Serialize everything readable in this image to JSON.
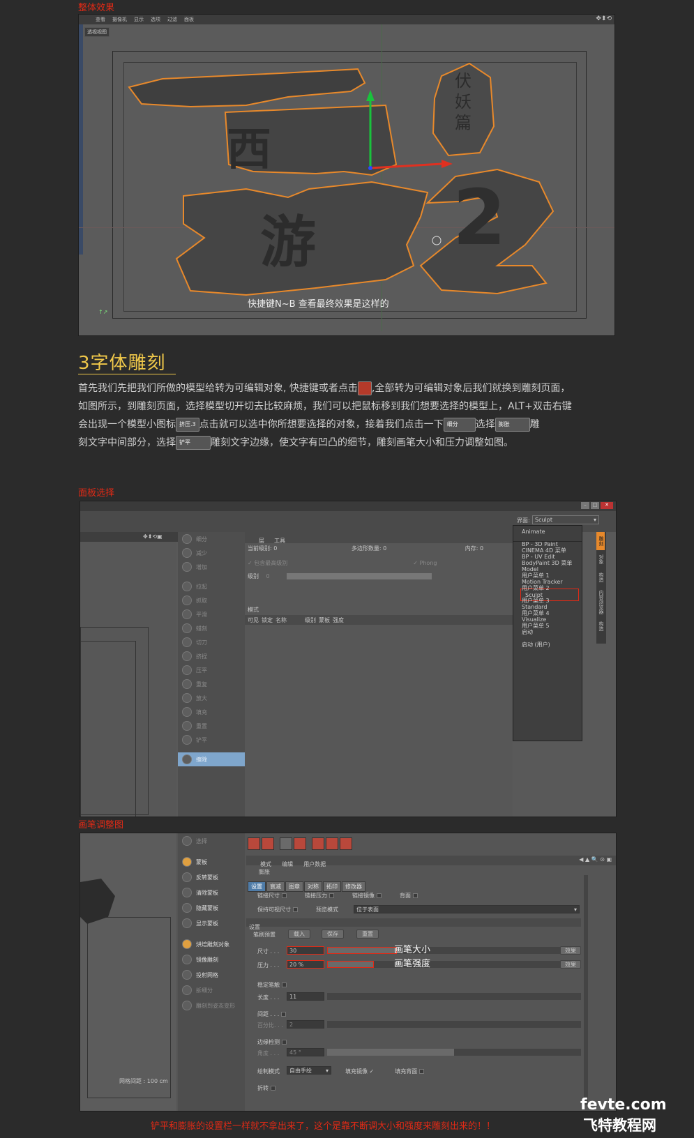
{
  "sections": {
    "overall_title": "整体效果",
    "panel_select_title": "面板选择",
    "brush_adjust_title": "画笔调整图"
  },
  "viewport1": {
    "menu": [
      "查看",
      "摄像机",
      "显示",
      "选项",
      "过滤",
      "面板"
    ],
    "view_tag": "透视视图",
    "caption": "快捷键N~B 查看最终效果是这样的",
    "art_text": {
      "xi": "西",
      "you": "游",
      "two": "2",
      "fu": "伏妖篇"
    }
  },
  "step3": {
    "heading": "3字体雕刻",
    "p1a": "首先我们先把我们所做的模型给转为可编辑对象, 快捷键或者点击",
    "p1b": ",全部转为可编辑对象后我们就换到雕刻页面，",
    "p2": "如图所示，到雕刻页面，选择模型切开切去比较麻烦，我们可以把鼠标移到我们想要选择的模型上，ALT+双击右键",
    "p3a": "会出现一个模型小图标",
    "icon_squeeze": "挤压.3",
    "p3b": "点击就可以选中你所想要选择的对象，接着我们点击一下",
    "icon_subdivide": "细分",
    "p3c": "选择",
    "icon_inflate": "膨胀",
    "p3d": "雕",
    "p4a": "刻文字中间部分，选择",
    "icon_flatten": "铲平",
    "p4b": "雕刻文字边缘，使文字有凹凸的细节，雕刻画笔大小和压力调整如图。"
  },
  "panel2": {
    "interface_label": "界面:",
    "interface_value": "Sculpt",
    "layer_tabs": [
      "层",
      "工具"
    ],
    "current_level_label": "当前级别:",
    "current_level": "0",
    "poly_count_label": "多边形数量:",
    "poly_count": "0",
    "memory_label": "内存:",
    "memory": "0",
    "include_high": "包含最高级别",
    "phong": "Phong",
    "level_label": "级别",
    "level_value": "0",
    "mode_label": "模式",
    "columns": [
      "可见",
      "锁定",
      "名称",
      "级别",
      "蒙板",
      "强度"
    ],
    "tools": [
      "细分",
      "减少",
      "增加",
      "拉起",
      "抓取",
      "平滑",
      "蜡刻",
      "切刀",
      "挤捏",
      "压平",
      "重复",
      "放大",
      "填充",
      "重置",
      "铲平",
      "擦除"
    ],
    "layout_items": [
      "Animate",
      "BP - 3D Paint",
      "BP - UV Edit",
      "Model",
      "Motion Tracker",
      "Sculpt",
      "Standard",
      "Visualize",
      "启动",
      "启动 (用户)"
    ],
    "menu_items": [
      "CINEMA 4D 菜单",
      "BodyPaint 3D 菜单",
      "用户菜单 1",
      "用户菜单 2",
      "用户菜单 3",
      "用户菜单 4",
      "用户菜单 5"
    ],
    "side_tabs": [
      "雕刻",
      "对象",
      "构造",
      "内容浏览器",
      "构造"
    ]
  },
  "panel3": {
    "tools": [
      "选择",
      "蒙板",
      "反转蒙板",
      "清除蒙板",
      "隐藏蒙板",
      "显示蒙板",
      "烘焙雕刻对象",
      "镜像雕刻",
      "投射网格",
      "拆细分",
      "雕刻到姿态变形"
    ],
    "grid_spacing": "网格间距 : 100 cm",
    "attr_menu": [
      "模式",
      "编辑",
      "用户数据"
    ],
    "tool_name": "膨胀",
    "tabs": [
      "设置",
      "衰减",
      "图章",
      "对称",
      "拓印",
      "修改器"
    ],
    "link_size": "链接尺寸",
    "link_pressure": "链接压力",
    "link_mirror": "链接镜像",
    "backface": "背面",
    "keep_visible_size": "保持可视尺寸",
    "preview_mode_label": "预览模式",
    "preview_mode": "位于表面",
    "settings_header": "设置",
    "brush_preset": "笔刷预置",
    "load_btn": "载入",
    "save_btn": "保存",
    "reset_btn": "重置",
    "size_label": "尺寸 . . .",
    "size_value": "30",
    "pressure_label": "压力 . . .",
    "pressure_value": "20 %",
    "effect_btn": "效果",
    "stabilize": "稳定笔触",
    "length_label": "长度 . . .",
    "length_value": "11",
    "spacing": "间距 . . .",
    "percent_label": "百分比. . .",
    "percent_value": "2",
    "edge_detect": "边缘检测",
    "angle_label": "角度 . . .",
    "angle_value": "45 °",
    "draw_mode_label": "绘制模式",
    "draw_mode": "自由手绘",
    "fill_mirror": "填充镜像",
    "fill_back": "填充背面",
    "fold": "折转",
    "annot_size": "画笔大小",
    "annot_strength": "画笔强度"
  },
  "footer_note": "铲平和膨胀的设置栏一样就不拿出来了，这个是靠不断调大小和强度来雕刻出来的！！",
  "watermark": {
    "site": "fevte.com",
    "cn": "飞特教程网"
  },
  "colors": {
    "accent_red": "#e02a16",
    "heading_gold": "#f0c84a",
    "outline_orange": "#e8892b",
    "select_blue": "#4f7ca8"
  }
}
